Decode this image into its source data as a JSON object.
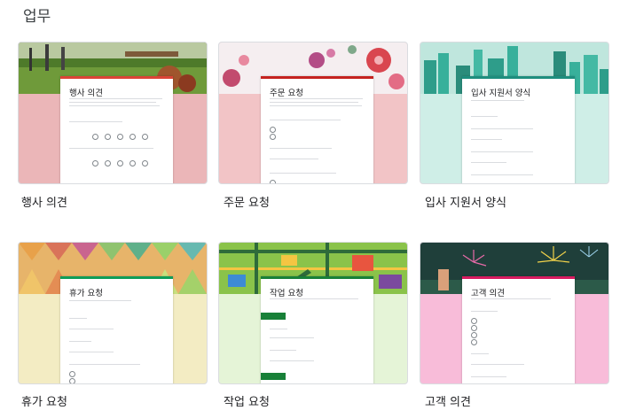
{
  "section": {
    "title": "업무"
  },
  "templates": [
    {
      "label": "행사 의견",
      "form_title": "행사 의견",
      "accent": "#db4437"
    },
    {
      "label": "주문 요청",
      "form_title": "주문 요청",
      "accent": "#c5221f"
    },
    {
      "label": "입사 지원서 양식",
      "form_title": "입사 지원서 양식",
      "accent": "#1e8e7e"
    },
    {
      "label": "휴가 요청",
      "form_title": "휴가 요청",
      "accent": "#0f9d58"
    },
    {
      "label": "작업 요청",
      "form_title": "작업 요청",
      "accent": "#188038"
    },
    {
      "label": "고객 의견",
      "form_title": "고객 의견",
      "accent": "#d81b60"
    }
  ]
}
